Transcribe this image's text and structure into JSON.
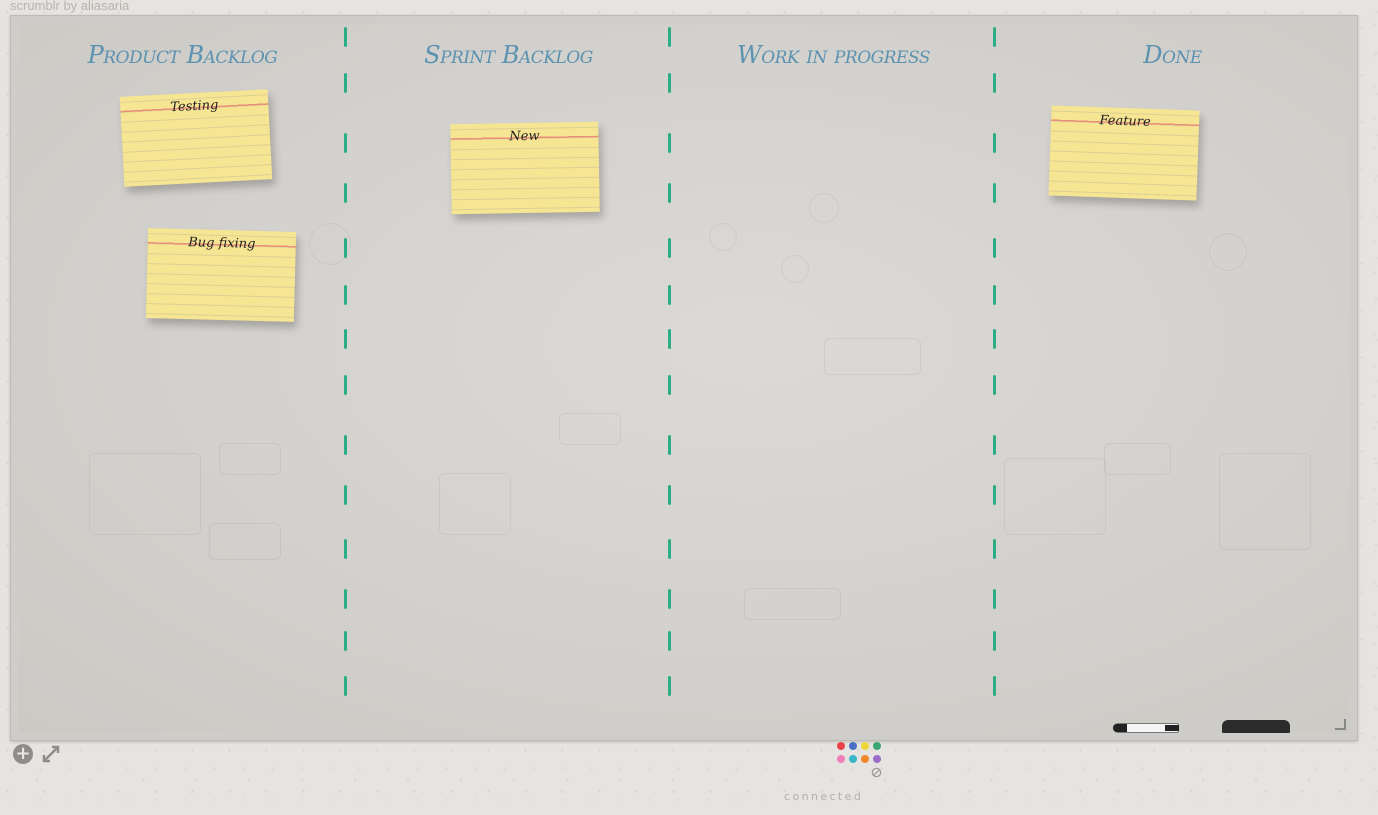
{
  "app": {
    "title": "scrumblr by aliasaria"
  },
  "columns": [
    {
      "title": "Product Backlog"
    },
    {
      "title": "Sprint Backlog"
    },
    {
      "title": "Work in progress"
    },
    {
      "title": "Done"
    }
  ],
  "cards": [
    {
      "text": "Testing",
      "column": "Product Backlog",
      "color": "#f6e592"
    },
    {
      "text": "Bug fixing",
      "column": "Product Backlog",
      "color": "#f6e592"
    },
    {
      "text": "New",
      "column": "Sprint Backlog",
      "color": "#f6e592"
    },
    {
      "text": "Feature",
      "column": "Done",
      "color": "#f6e592"
    }
  ],
  "toolbar": {
    "add_icon": "add-card-icon",
    "fullscreen_icon": "fullscreen-expand-icon"
  },
  "palette": {
    "colors": [
      "#e8424a",
      "#4a6fc4",
      "#efd63b",
      "#3aa774",
      "#f07fb8",
      "#3ab5c8",
      "#f0862a",
      "#9a6cc8"
    ],
    "clear_icon": "no-color-icon"
  },
  "status": {
    "text": "connected"
  },
  "accent": {
    "column_title": "#5b92b0",
    "divider": "#2bad86"
  }
}
